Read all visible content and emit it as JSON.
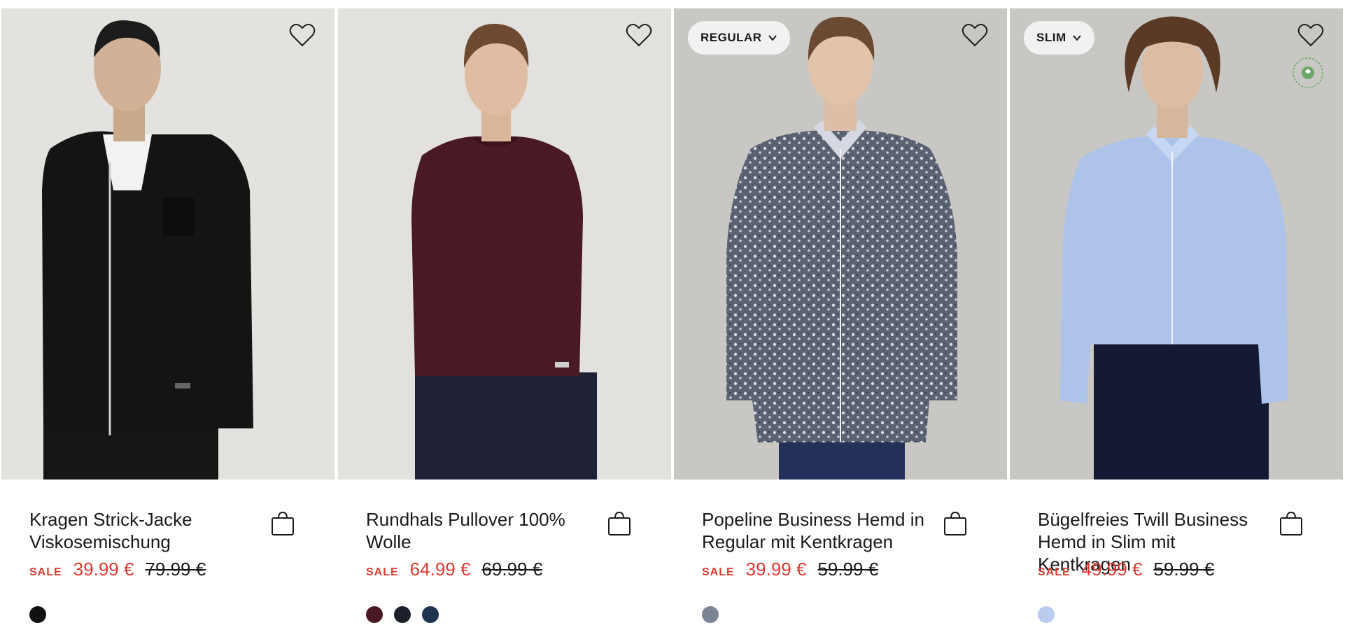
{
  "products": [
    {
      "title": "Kragen Strick-Jacke Viskosemischung",
      "sale_label": "SALE",
      "price": "39.99 €",
      "old_price": "79.99 €",
      "fit": "",
      "bg": "#e3e2de",
      "garment": "#141414",
      "swatches": [
        "#111111"
      ]
    },
    {
      "title": "Rundhals Pullover 100% Wolle",
      "sale_label": "SALE",
      "price": "64.99 €",
      "old_price": "69.99 €",
      "fit": "",
      "bg": "#e2e1dd",
      "garment": "#4a1a24",
      "swatches": [
        "#4a1a24",
        "#1b1f2a",
        "#1f3450"
      ]
    },
    {
      "title": "Popeline Business Hemd in Regular mit Kentkragen",
      "sale_label": "SALE",
      "price": "39.99 €",
      "old_price": "59.99 €",
      "fit": "REGULAR",
      "bg": "#c9c7c4",
      "garment": "#5b6272",
      "swatches": [
        "#7c8496"
      ]
    },
    {
      "title": "Bügelfreies Twill Business Hemd in Slim mit Kentkragen",
      "sale_label": "SALE",
      "price": "49.99 €",
      "old_price": "59.99 €",
      "fit": "SLIM",
      "bg": "#c8c7c4",
      "garment": "#aec3ea",
      "swatches": [
        "#b9cbee"
      ]
    }
  ],
  "colors": {
    "sale": "#e03a2f",
    "text": "#1a1a1a",
    "badge_bg": "#f1f1f1"
  },
  "icons": {
    "wishlist": "heart-icon",
    "cart": "shopping-bag-icon",
    "fit_toggle": "chevron-down-icon",
    "eco": "sustainability-badge-icon"
  }
}
